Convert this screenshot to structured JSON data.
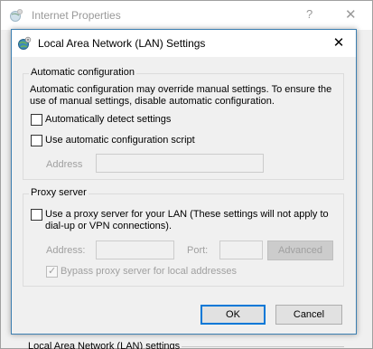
{
  "parent": {
    "title": "Internet Properties",
    "help_glyph": "?",
    "close_glyph": "✕",
    "bottom_text": "Local Area Network (LAN) settings"
  },
  "dialog": {
    "title": "Local Area Network (LAN) Settings",
    "close_glyph": "✕"
  },
  "auto_config": {
    "legend": "Automatic configuration",
    "description_line1": "Automatic configuration may override manual settings.  To ensure the",
    "description_line2": "use of manual settings, disable automatic configuration.",
    "detect_label": "Automatically detect settings",
    "detect_checked": false,
    "script_label": "Use automatic configuration script",
    "script_checked": false,
    "address_label": "Address",
    "address_value": ""
  },
  "proxy": {
    "legend": "Proxy server",
    "use_proxy_line1": "Use a proxy server for your LAN (These settings will not apply to",
    "use_proxy_line2": "dial-up or VPN connections).",
    "use_proxy_checked": false,
    "address_label": "Address:",
    "address_value": "",
    "port_label": "Port:",
    "port_value": "",
    "advanced_label": "Advanced",
    "bypass_label": "Bypass proxy server for local addresses",
    "bypass_checked": true
  },
  "buttons": {
    "ok": "OK",
    "cancel": "Cancel"
  },
  "colors": {
    "accent": "#0078d7",
    "disabled_text": "#a0a0a0"
  }
}
